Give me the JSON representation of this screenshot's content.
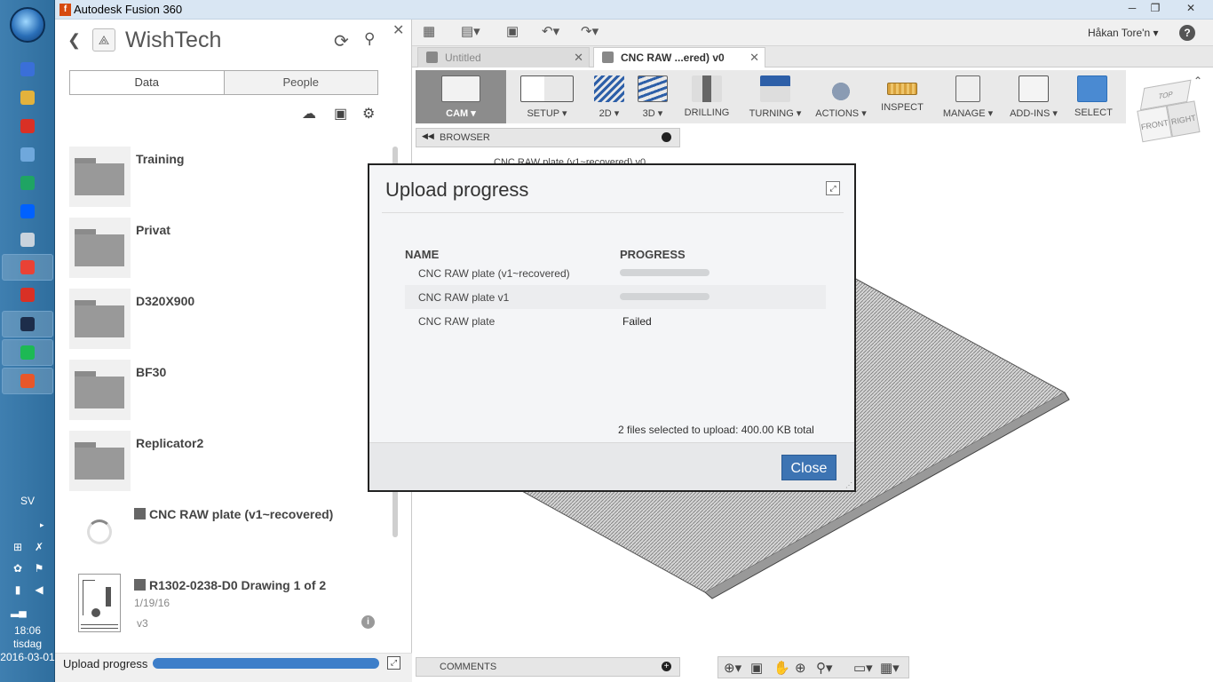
{
  "window": {
    "title": "Autodesk Fusion 360",
    "app_icon": "f",
    "controls": {
      "minimize": "─",
      "maximize": "❐",
      "close": "✕"
    }
  },
  "taskbar": {
    "language": "SV",
    "clock": {
      "time": "18:06",
      "day": "tisdag",
      "date": "2016-03-01"
    },
    "apps": [
      {
        "name": "calendar-icon",
        "color": "#3a6fd8"
      },
      {
        "name": "file-explorer-icon",
        "color": "#e3b23c"
      },
      {
        "name": "media-app-icon",
        "color": "#d93025"
      },
      {
        "name": "paint-icon",
        "color": "#6fa8dc"
      },
      {
        "name": "google-drive-icon",
        "color": "#1fa463"
      },
      {
        "name": "dropbox-icon",
        "color": "#0061ff"
      },
      {
        "name": "calculator-icon",
        "color": "#c9d3dd"
      },
      {
        "name": "chrome-icon",
        "color": "#e94235"
      },
      {
        "name": "gmail-icon",
        "color": "#d93025"
      },
      {
        "name": "remote-app-icon",
        "color": "#1d2d4a"
      },
      {
        "name": "spotify-icon",
        "color": "#1db954"
      },
      {
        "name": "fusion-360-icon",
        "color": "#e8572a"
      }
    ]
  },
  "data_panel": {
    "project_name": "WishTech",
    "tabs": [
      {
        "label": "Data"
      },
      {
        "label": "People"
      }
    ],
    "items": [
      {
        "name": "Training",
        "type": "folder"
      },
      {
        "name": "Privat",
        "type": "folder"
      },
      {
        "name": "D320X900",
        "type": "folder"
      },
      {
        "name": "BF30",
        "type": "folder"
      },
      {
        "name": "Replicator2",
        "type": "folder"
      },
      {
        "name": "CNC RAW plate (v1~recovered)",
        "type": "design-uploading"
      },
      {
        "name": "R1302-0238-D0 Drawing 1 of 2",
        "type": "drawing",
        "date": "1/19/16",
        "version": "v3"
      }
    ],
    "upload": {
      "label": "Upload progress",
      "progress": 1.0
    }
  },
  "main": {
    "user": "Håkan Tore'n",
    "tabs": [
      {
        "label": "Untitled",
        "active": false
      },
      {
        "label": "CNC RAW ...ered) v0",
        "active": true
      }
    ],
    "toolbar": [
      {
        "label": "CAM ▾",
        "icon": "cam-workspace-icon"
      },
      {
        "label": "SETUP ▾",
        "icon": "setup-icon"
      },
      {
        "label": "2D ▾",
        "icon": "2d-toolpath-icon"
      },
      {
        "label": "3D ▾",
        "icon": "3d-toolpath-icon"
      },
      {
        "label": "DRILLING",
        "icon": "drilling-icon"
      },
      {
        "label": "TURNING ▾",
        "icon": "turning-icon"
      },
      {
        "label": "ACTIONS ▾",
        "icon": "actions-icon"
      },
      {
        "label": "INSPECT",
        "icon": "inspect-icon"
      },
      {
        "label": "MANAGE ▾",
        "icon": "manage-icon"
      },
      {
        "label": "ADD-INS ▾",
        "icon": "add-ins-icon"
      },
      {
        "label": "SELECT",
        "icon": "select-icon"
      }
    ],
    "viewcube": {
      "top": "TOP",
      "front": "FRONT",
      "right": "RIGHT"
    },
    "browser": {
      "label": "BROWSER",
      "node": "CNC RAW plate (v1~recovered) v0"
    },
    "comments": {
      "label": "COMMENTS"
    }
  },
  "dialog": {
    "title": "Upload progress",
    "columns": {
      "name": "NAME",
      "progress": "PROGRESS"
    },
    "rows": [
      {
        "name": "CNC RAW plate (v1~recovered)",
        "status": "",
        "bar": true
      },
      {
        "name": "CNC RAW plate v1",
        "status": "",
        "bar": true
      },
      {
        "name": "CNC RAW plate",
        "status": "Failed",
        "bar": false
      }
    ],
    "summary": "2 files selected to upload: 400.00 KB total",
    "close_label": "Close"
  }
}
